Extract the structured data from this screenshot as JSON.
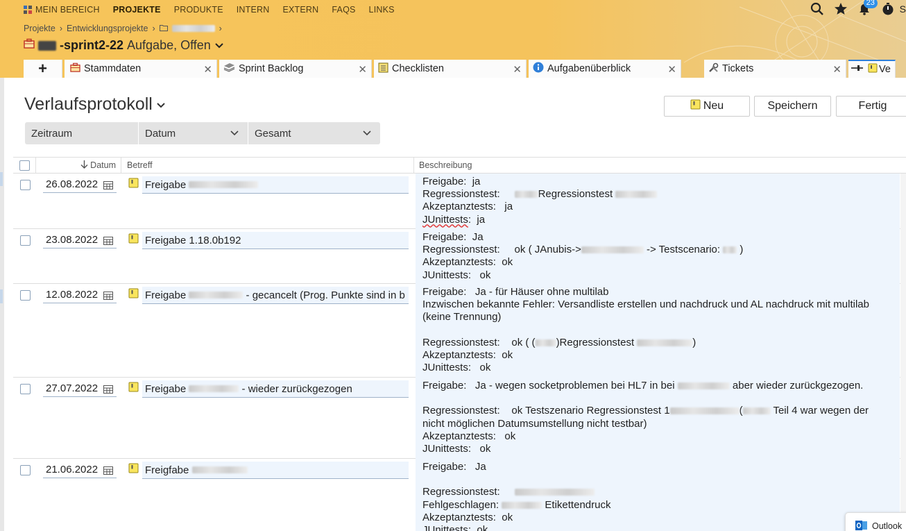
{
  "nav": {
    "items": [
      {
        "label": "MEIN BEREICH",
        "icon": "grid-icon",
        "active": false
      },
      {
        "label": "PROJEKTE",
        "active": true
      },
      {
        "label": "PRODUKTE",
        "active": false
      },
      {
        "label": "INTERN",
        "active": false
      },
      {
        "label": "EXTERN",
        "active": false
      },
      {
        "label": "FAQS",
        "active": false
      },
      {
        "label": "LINKS",
        "active": false
      }
    ],
    "notification_count": "23",
    "user_initial": "S"
  },
  "breadcrumb": {
    "items": [
      "Projekte",
      "Entwicklungsprojekte"
    ],
    "separator": "›"
  },
  "header": {
    "title": "-sprint2-22",
    "status": "Aufgabe, Offen"
  },
  "tabs": [
    {
      "label": "Stammdaten",
      "icon": "briefcase-icon"
    },
    {
      "label": "Sprint Backlog",
      "icon": "stack-icon"
    },
    {
      "label": "Checklisten",
      "icon": "checklist-icon"
    },
    {
      "label": "Aufgabenüberblick",
      "icon": "info-icon"
    },
    {
      "label": "Tickets",
      "icon": "tools-icon"
    },
    {
      "label": "Ve",
      "icon": "note-icon"
    }
  ],
  "page": {
    "title": "Verlaufsprotokoll",
    "buttons": {
      "new": "Neu",
      "save": "Speichern",
      "done": "Fertig"
    },
    "filter": {
      "range_label": "Zeitraum",
      "date_label": "Datum",
      "total_label": "Gesamt"
    }
  },
  "table": {
    "headers": {
      "date": "Datum",
      "subject": "Betreff",
      "description": "Beschreibung"
    },
    "rows": [
      {
        "date": "26.08.2022",
        "subject": "Freigabe",
        "desc": [
          {
            "t": "Freigabe:  ja"
          },
          {
            "t": "Regressionstest:     ",
            "b": 34,
            "t2": "Regressionstest ",
            "b2": 60
          },
          {
            "t": "Akzeptanztests:   ja"
          },
          {
            "t": "JUnittests",
            "spell": true,
            "t2": ":  ja"
          }
        ]
      },
      {
        "date": "23.08.2022",
        "subject": "Freigabe 1.18.0b192",
        "desc": [
          {
            "t": "Freigabe:  Ja"
          },
          {
            "t": "Regressionstest:     ok ( JAnubis->",
            "b": 90,
            "t2": " -> Testscenario: ",
            "b2": 20,
            "t3": " )"
          },
          {
            "t": "Akzeptanztests:  ok"
          },
          {
            "t": "JUnittests:   ok"
          }
        ]
      },
      {
        "date": "12.08.2022",
        "subject": "Freigabe",
        "subject_suffix": " - gecancelt (Prog. Punkte sind in b",
        "desc": [
          {
            "t": "Freigabe:   Ja - für Häuser ohne multilab"
          },
          {
            "t": "Inzwischen bekannte Fehler: Versandliste erstellen und nachdruck und AL nachdruck mit multilab"
          },
          {
            "t": "(keine Trennung)"
          },
          {
            "t": ""
          },
          {
            "t": "Regressionstest:    ok ( (",
            "b": 30,
            "t2": ")Regressionstest ",
            "b2": 80,
            "t3": ")"
          },
          {
            "t": "Akzeptanztests:  ok"
          },
          {
            "t": "JUnittests:   ok"
          }
        ]
      },
      {
        "date": "27.07.2022",
        "subject": "Freigabe",
        "subject_suffix": " - wieder zurückgezogen",
        "desc": [
          {
            "t": "Freigabe:   Ja - wegen socketproblemen bei HL7 in bei ",
            "b": 75,
            "t2": " aber wieder zurückgezogen."
          },
          {
            "t": ""
          },
          {
            "t": "Regressionstest:    ok Testszenario Regressionstest 1",
            "b": 100,
            "t2": "(",
            "b2": 40,
            "t3": " Teil 4 war wegen der"
          },
          {
            "t": "nicht möglichen Datumsumstellung nicht testbar)"
          },
          {
            "t": "Akzeptanztests:   ok"
          },
          {
            "t": "JUnittests:   ok"
          }
        ]
      },
      {
        "date": "21.06.2022",
        "subject": "Freigfabe",
        "desc": [
          {
            "t": "Freigabe:   Ja"
          },
          {
            "t": ""
          },
          {
            "t": "Regressionstest:     ",
            "b": 115
          },
          {
            "t": "Fehlgeschlagen: ",
            "b": 58,
            "t2": " Etikettendruck"
          },
          {
            "t": "Akzeptanztests:  ok"
          },
          {
            "t": "JUnittests:  ok"
          }
        ]
      }
    ]
  },
  "outlook": {
    "label": "Outlook"
  }
}
